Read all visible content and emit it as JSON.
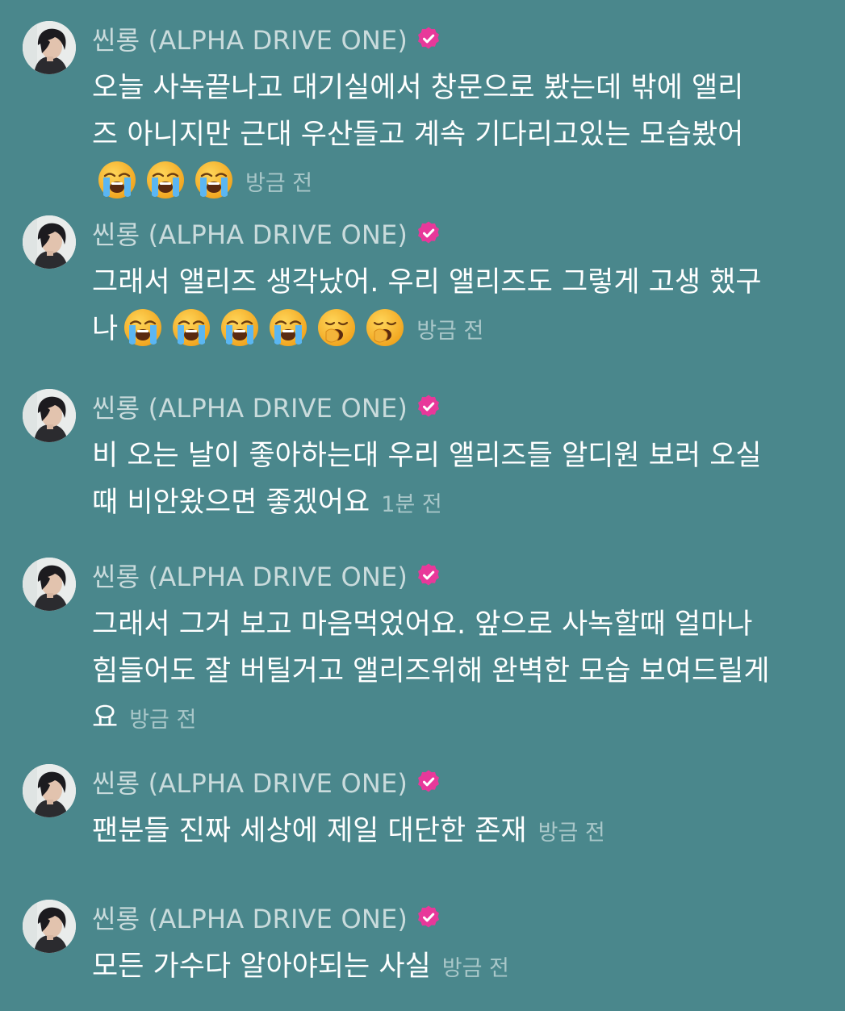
{
  "author": {
    "name": "씬롱 (ALPHA DRIVE ONE)",
    "avatar_icon": "profile-photo",
    "badge_icon": "verified-badge-icon",
    "badge_color": "#e8389a"
  },
  "messages": [
    {
      "text": "오늘 사녹끝나고 대기실에서 창문으로 봤는데 밖에 앨리즈 아니지만 근대 우산들고 계속 기다리고있는 모습봤어",
      "emojis": [
        "loudly-crying-face",
        "loudly-crying-face",
        "loudly-crying-face"
      ],
      "time": "방금 전"
    },
    {
      "text": "그래서 앨리즈 생각났어. 우리 앨리즈도 그렇게 고생 했구나",
      "emojis": [
        "loudly-crying-face",
        "loudly-crying-face",
        "loudly-crying-face",
        "loudly-crying-face",
        "yawning-face",
        "yawning-face"
      ],
      "time": "방금 전"
    },
    {
      "text": "비 오는 날이 좋아하는대 우리 앨리즈들 알디원 보러 오실때 비안왔으면 좋겠어요",
      "emojis": [],
      "time": "1분 전"
    },
    {
      "text": "그래서 그거 보고 마음먹었어요. 앞으로 사녹할때 얼마나 힘들어도 잘 버틸거고 앨리즈위해 완벽한 모습 보여드릴게요",
      "emojis": [],
      "time": "방금 전"
    },
    {
      "text": "팬분들 진짜 세상에 제일 대단한 존재",
      "emojis": [],
      "time": "방금 전"
    },
    {
      "text": "모든 가수다 알아야되는 사실",
      "emojis": [],
      "time": "방금 전"
    }
  ]
}
